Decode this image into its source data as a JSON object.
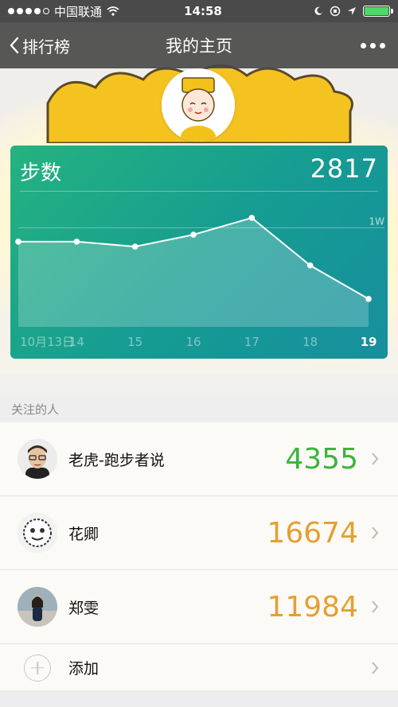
{
  "status_bar": {
    "carrier": "中国联通",
    "time": "14:58"
  },
  "nav": {
    "back_label": "排行榜",
    "title": "我的主页"
  },
  "chart_card": {
    "label": "步数",
    "value": "2817",
    "ref_line_label": "1W",
    "accent": "#1fa78a"
  },
  "chart_data": {
    "type": "area",
    "title": "步数",
    "categories": [
      "10月13日",
      "14",
      "15",
      "16",
      "17",
      "18",
      "19"
    ],
    "values": [
      8600,
      8600,
      8100,
      9300,
      11000,
      6200,
      2817
    ],
    "reference_line": {
      "label": "1W",
      "value": 10000
    },
    "ylim": [
      0,
      13000
    ],
    "highlight": "19"
  },
  "section": {
    "following_header": "关注的人"
  },
  "following": [
    {
      "name": "老虎-跑步者说",
      "steps": "4355",
      "color": "#3cb43c"
    },
    {
      "name": "花卿",
      "steps": "16674",
      "color": "#e5a030"
    },
    {
      "name": "郑雯",
      "steps": "11984",
      "color": "#e5a030"
    }
  ],
  "add_label": "添加"
}
